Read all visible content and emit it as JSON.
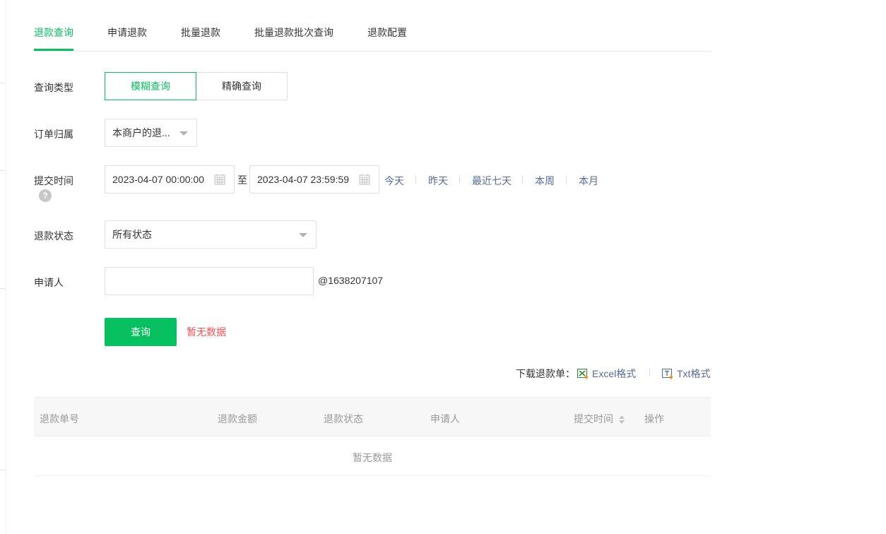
{
  "tabs": [
    {
      "label": "退款查询",
      "active": true
    },
    {
      "label": "申请退款",
      "active": false
    },
    {
      "label": "批量退款",
      "active": false
    },
    {
      "label": "批量退款批次查询",
      "active": false
    },
    {
      "label": "退款配置",
      "active": false
    }
  ],
  "form": {
    "query_type": {
      "label": "查询类型",
      "options": [
        "模糊查询",
        "精确查询"
      ],
      "selected": "模糊查询"
    },
    "order_owner": {
      "label": "订单归属",
      "value": "本商户的退..."
    },
    "submit_time": {
      "label": "提交时间",
      "help_icon": "?",
      "start": "2023-04-07 00:00:00",
      "to_label": "至",
      "end": "2023-04-07 23:59:59",
      "quick_ranges": [
        "今天",
        "昨天",
        "最近七天",
        "本周",
        "本月"
      ],
      "separator": "|"
    },
    "refund_status": {
      "label": "退款状态",
      "value": "所有状态"
    },
    "applicant": {
      "label": "申请人",
      "value": "",
      "suffix": "@1638207107"
    }
  },
  "actions": {
    "query_label": "查询",
    "no_data_hint": "暂无数据"
  },
  "download": {
    "label": "下载退款单：",
    "excel": "Excel格式",
    "txt": "Txt格式",
    "separator": "|"
  },
  "table": {
    "columns": [
      "退款单号",
      "退款金额",
      "退款状态",
      "申请人",
      "提交时间",
      "操作"
    ],
    "empty_text": "暂无数据"
  },
  "colors": {
    "accent": "#07c160",
    "link": "#576b95",
    "error": "#fa5151"
  }
}
